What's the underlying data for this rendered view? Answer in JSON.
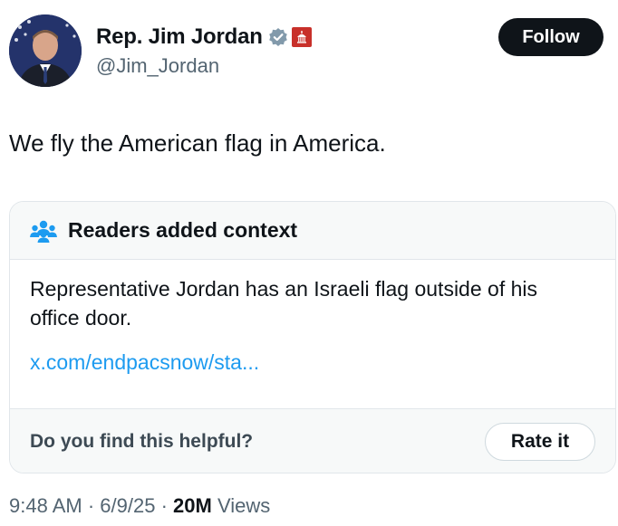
{
  "author": {
    "display_name": "Rep. Jim Jordan",
    "handle": "@Jim_Jordan",
    "verified_icon": "verified-badge-icon",
    "affiliation_icon": "government-badge-icon"
  },
  "follow_button": {
    "label": "Follow"
  },
  "tweet": {
    "text": "We fly the American flag in America."
  },
  "community_note": {
    "title": "Readers added context",
    "body": "Representative Jordan has an Israeli flag outside of his office door.",
    "link": "x.com/endpacsnow/sta...",
    "helpful_prompt": "Do you find this helpful?",
    "rate_button": "Rate it"
  },
  "meta": {
    "time": "9:48 AM",
    "separator": "·",
    "date": "6/9/25",
    "views_count": "20M",
    "views_label": "Views"
  },
  "colors": {
    "text": "#0f1419",
    "secondary": "#536471",
    "link": "#1d9bf0",
    "verified": "#829aab",
    "gov_badge": "#c8302a",
    "note_bg": "#f7f9f9"
  }
}
